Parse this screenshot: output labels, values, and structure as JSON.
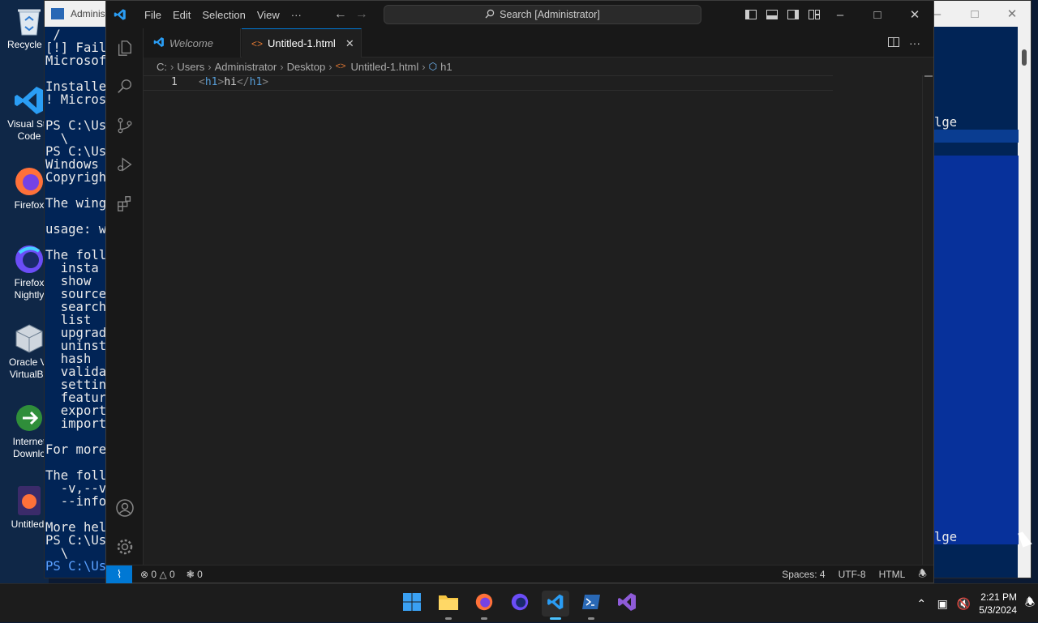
{
  "desktop": {
    "icons": [
      {
        "label": "Recycle B",
        "icon": "recycle-bin-icon"
      },
      {
        "label": "Visual Stu\nCode",
        "icon": "vscode-icon"
      },
      {
        "label": "Firefox",
        "icon": "firefox-icon"
      },
      {
        "label": "Firefox\nNightly",
        "icon": "firefox-nightly-icon"
      },
      {
        "label": "Oracle VI\nVirtualBo",
        "icon": "virtualbox-icon"
      },
      {
        "label": "Internet\nDownlo",
        "icon": "idm-icon"
      },
      {
        "label": "Untitled-",
        "icon": "html-file-icon"
      }
    ]
  },
  "powershell": {
    "title": "Adminis",
    "lines": [
      " /",
      "[!] Fail",
      "Microsof",
      "",
      "Installe",
      "! Micros",
      "",
      "PS C:\\Us",
      "  \\",
      "PS C:\\Us",
      "Windows",
      "Copyrigh",
      "",
      "The wing",
      "",
      "usage: w",
      "",
      "The foll",
      "  insta",
      "  show",
      "  source",
      "  search",
      "  list",
      "  upgrad",
      "  uninst",
      "  hash",
      "  valida",
      "  settin",
      "  featur",
      "  export",
      "  import",
      "",
      "For more",
      "",
      "The foll",
      "  -v,--v",
      "  --info",
      "",
      "More hel",
      "PS C:\\Us",
      "  \\",
      "PS C:\\Us"
    ],
    "right_text_1": "lge",
    "right_text_2": "lge"
  },
  "vscode": {
    "menu": [
      "File",
      "Edit",
      "Selection",
      "View",
      "···"
    ],
    "search_placeholder": "Search [Administrator]",
    "tabs": [
      {
        "label": "Welcome",
        "icon": "vscode-icon",
        "active": false
      },
      {
        "label": "Untitled-1.html",
        "icon": "html-icon",
        "active": true
      }
    ],
    "breadcrumb": [
      "C:",
      "Users",
      "Administrator",
      "Desktop",
      "Untitled-1.html",
      "h1"
    ],
    "editor": {
      "line_number": "1",
      "code": {
        "open_lt": "<",
        "open_tag": "h1",
        "open_gt": ">",
        "text": "hi",
        "close_lt": "</",
        "close_tag": "h1",
        "close_gt": ">"
      }
    },
    "status": {
      "errors": "0",
      "warnings": "0",
      "ports": "0",
      "spaces": "Spaces: 4",
      "encoding": "UTF-8",
      "language": "HTML"
    }
  },
  "taskbar": {
    "apps": [
      "start-icon",
      "file-explorer-icon",
      "firefox-icon",
      "firefox-nightly-icon",
      "vscode-icon",
      "powershell-icon",
      "visual-studio-icon"
    ],
    "time": "2:21 PM",
    "date": "5/3/2024"
  }
}
